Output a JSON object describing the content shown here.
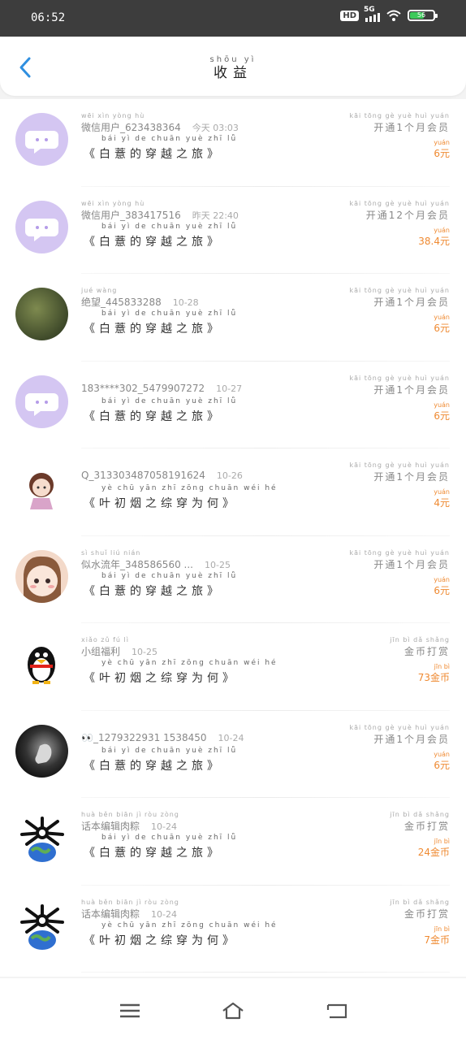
{
  "status": {
    "time": "06:52",
    "hd": "HD",
    "network": "5G",
    "battery": "56"
  },
  "header": {
    "title_pinyin": "shōu  yì",
    "title": "收益"
  },
  "rows": [
    {
      "avatar": "av-purple",
      "name_pinyin": "wēi  xìn  yòng  hù",
      "name": "微信用户_623438364",
      "date": "今天 03:03",
      "book_pinyin": "bái   yì   de  chuān yuè  zhī   lǚ",
      "book": "《白薏的穿越之旅》",
      "type_pinyin": "kāi tōng    gè   yuè  huì yuán",
      "type": "开通1个月会员",
      "amount_pinyin": "yuán",
      "amount": "6元"
    },
    {
      "avatar": "av-purple",
      "name_pinyin": "wēi  xìn  yòng  hù",
      "name": "微信用户_383417516",
      "date": "昨天 22:40",
      "book_pinyin": "bái   yì   de  chuān yuè  zhī   lǚ",
      "book": "《白薏的穿越之旅》",
      "type_pinyin": "kāi tōng      gè   yuè  huì yuán",
      "type": "开通12个月会员",
      "amount_pinyin": "yuán",
      "amount": "38.4元"
    },
    {
      "avatar": "av-grass",
      "name_pinyin": "jué  wàng",
      "name": "绝望_445833288",
      "date": "10-28",
      "book_pinyin": "bái   yì   de  chuān yuè  zhī   lǚ",
      "book": "《白薏的穿越之旅》",
      "type_pinyin": "kāi tōng    gè   yuè  huì yuán",
      "type": "开通1个月会员",
      "amount_pinyin": "yuán",
      "amount": "6元"
    },
    {
      "avatar": "av-purple",
      "name_pinyin": "",
      "name": "183****302_5479907272",
      "date": "10-27",
      "book_pinyin": "bái   yì   de  chuān yuè  zhī   lǚ",
      "book": "《白薏的穿越之旅》",
      "type_pinyin": "kāi tōng    gè   yuè  huì yuán",
      "type": "开通1个月会员",
      "amount_pinyin": "yuán",
      "amount": "6元"
    },
    {
      "avatar": "av-girl",
      "name_pinyin": "",
      "name": "Q_313303487058191624",
      "date": "10-26",
      "book_pinyin": "yè   chū  yān  zhī zōng chuān wéi  hé",
      "book": "《叶初烟之综穿为何》",
      "type_pinyin": "kāi tōng    gè   yuè  huì yuán",
      "type": "开通1个月会员",
      "amount_pinyin": "yuán",
      "amount": "4元"
    },
    {
      "avatar": "av-anime",
      "name_pinyin": "sì  shuǐ  liú  nián",
      "name": "似水流年_348586560 ...",
      "date": "10-25",
      "book_pinyin": "bái   yì   de  chuān yuè  zhī   lǚ",
      "book": "《白薏的穿越之旅》",
      "type_pinyin": "kāi tōng    gè   yuè  huì yuán",
      "type": "开通1个月会员",
      "amount_pinyin": "yuán",
      "amount": "6元"
    },
    {
      "avatar": "av-penguin",
      "name_pinyin": "xiǎo  zǔ   fú   lì",
      "name": "小组福利",
      "date": "10-25",
      "book_pinyin": "yè   chū  yān  zhī zōng chuān wéi  hé",
      "book": "《叶初烟之综穿为何》",
      "type_pinyin": "jīn  bì   dǎ  shǎng",
      "type": "金币打赏",
      "amount_pinyin": "jīn  bì",
      "amount": "73金币"
    },
    {
      "avatar": "av-dark",
      "name_pinyin": "",
      "name": "👀_1279322931 1538450",
      "date": "10-24",
      "book_pinyin": "bái   yì   de  chuān yuè  zhī   lǚ",
      "book": "《白薏的穿越之旅》",
      "type_pinyin": "kāi tōng    gè   yuè  huì yuán",
      "type": "开通1个月会员",
      "amount_pinyin": "yuán",
      "amount": "6元"
    },
    {
      "avatar": "av-earth",
      "name_pinyin": "huà  běn  biān   jì  ròu  zòng",
      "name": "话本编辑肉粽",
      "date": "10-24",
      "book_pinyin": "bái   yì   de  chuān yuè  zhī   lǚ",
      "book": "《白薏的穿越之旅》",
      "type_pinyin": "jīn  bì   dǎ  shǎng",
      "type": "金币打赏",
      "amount_pinyin": "jīn  bì",
      "amount": "24金币"
    },
    {
      "avatar": "av-earth",
      "name_pinyin": "huà  běn  biān   jì  ròu  zòng",
      "name": "话本编辑肉粽",
      "date": "10-24",
      "book_pinyin": "yè   chū  yān  zhī zōng chuān wéi  hé",
      "book": "《叶初烟之综穿为何》",
      "type_pinyin": "jīn  bì   dǎ  shǎng",
      "type": "金币打赏",
      "amount_pinyin": "jīn  bì",
      "amount": "7金币"
    }
  ]
}
